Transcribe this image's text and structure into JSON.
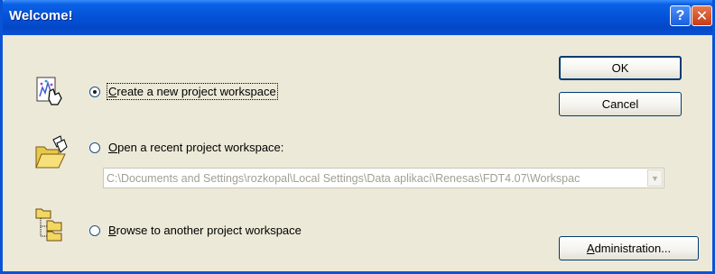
{
  "window": {
    "title": "Welcome!",
    "help_symbol": "?",
    "close_symbol": "✕"
  },
  "options": {
    "new_project": {
      "accel": "C",
      "label_rest": "reate a new project workspace",
      "selected": true,
      "icon": "new-project-icon"
    },
    "recent_project": {
      "accel": "O",
      "label_rest": "pen a recent project workspace:",
      "selected": false,
      "icon": "open-folder-icon",
      "path_value": "C:\\Documents and Settings\\rozkopal\\Local Settings\\Data aplikací\\Renesas\\FDT4.07\\Workspac"
    },
    "browse_project": {
      "accel": "B",
      "label_rest": "rowse to another project workspace",
      "selected": false,
      "icon": "folder-tree-icon"
    }
  },
  "buttons": {
    "ok": "OK",
    "cancel": "Cancel",
    "admin_accel": "A",
    "admin_rest": "dministration..."
  },
  "colors": {
    "titlebar": "#0453d8",
    "dialog_bg": "#ece9d8",
    "close": "#c73b16"
  }
}
